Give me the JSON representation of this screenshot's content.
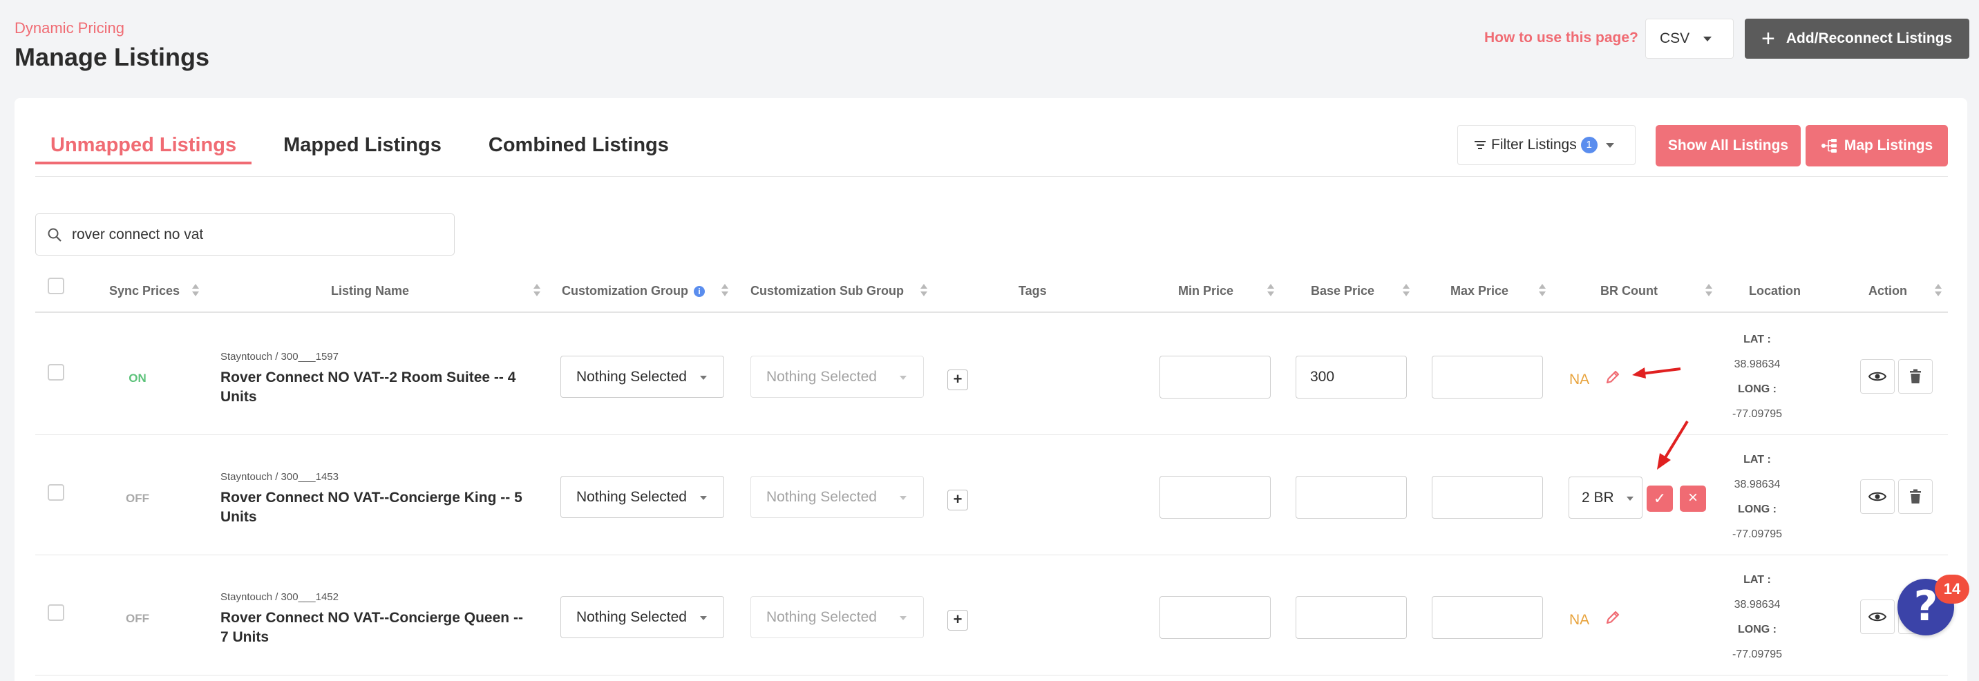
{
  "header": {
    "breadcrumb": "Dynamic Pricing",
    "title": "Manage Listings",
    "help_link": "How to use this page?",
    "export_select": "CSV",
    "add_button": "Add/Reconnect Listings"
  },
  "tabs": [
    {
      "label": "Unmapped Listings",
      "active": true
    },
    {
      "label": "Mapped Listings",
      "active": false
    },
    {
      "label": "Combined Listings",
      "active": false
    }
  ],
  "toolbar": {
    "filter_label": "Filter Listings",
    "filter_count": "1",
    "show_all_label": "Show All Listings",
    "map_label": "Map Listings"
  },
  "search": {
    "value": "rover connect no vat"
  },
  "columns": {
    "sync": "Sync Prices",
    "name": "Listing Name",
    "group": "Customization Group",
    "subgroup": "Customization Sub Group",
    "tags": "Tags",
    "min": "Min Price",
    "base": "Base Price",
    "max": "Max Price",
    "br": "BR Count",
    "location": "Location",
    "action": "Action"
  },
  "location_labels": {
    "lat": "LAT :",
    "long": "LONG :"
  },
  "rows": [
    {
      "sync": "ON",
      "source": "Stayntouch / 300___1597",
      "name": "Rover Connect NO VAT--2 Room Suitee -- 4 Units",
      "group": "Nothing Selected",
      "subgroup": "Nothing Selected",
      "min_price": "",
      "base_price": "300",
      "max_price": "",
      "br_count": "NA",
      "lat": "38.98634",
      "long": "-77.09795"
    },
    {
      "sync": "OFF",
      "source": "Stayntouch / 300___1453",
      "name": "Rover Connect NO VAT--Concierge King -- 5 Units",
      "group": "Nothing Selected",
      "subgroup": "Nothing Selected",
      "min_price": "",
      "base_price": "",
      "max_price": "",
      "br_count": "2 BR",
      "lat": "38.98634",
      "long": "-77.09795"
    },
    {
      "sync": "OFF",
      "source": "Stayntouch / 300___1452",
      "name": "Rover Connect NO VAT--Concierge Queen -- 7 Units",
      "group": "Nothing Selected",
      "subgroup": "Nothing Selected",
      "min_price": "",
      "base_price": "",
      "max_price": "",
      "br_count": "NA",
      "lat": "38.98634",
      "long": "-77.09795"
    }
  ],
  "help_widget": {
    "badge": "14"
  },
  "colors": {
    "accent": "#f06b73",
    "dark_button": "#5b5b5b",
    "on": "#5cc27a",
    "na": "#e8a33c",
    "info": "#5a8dee"
  }
}
